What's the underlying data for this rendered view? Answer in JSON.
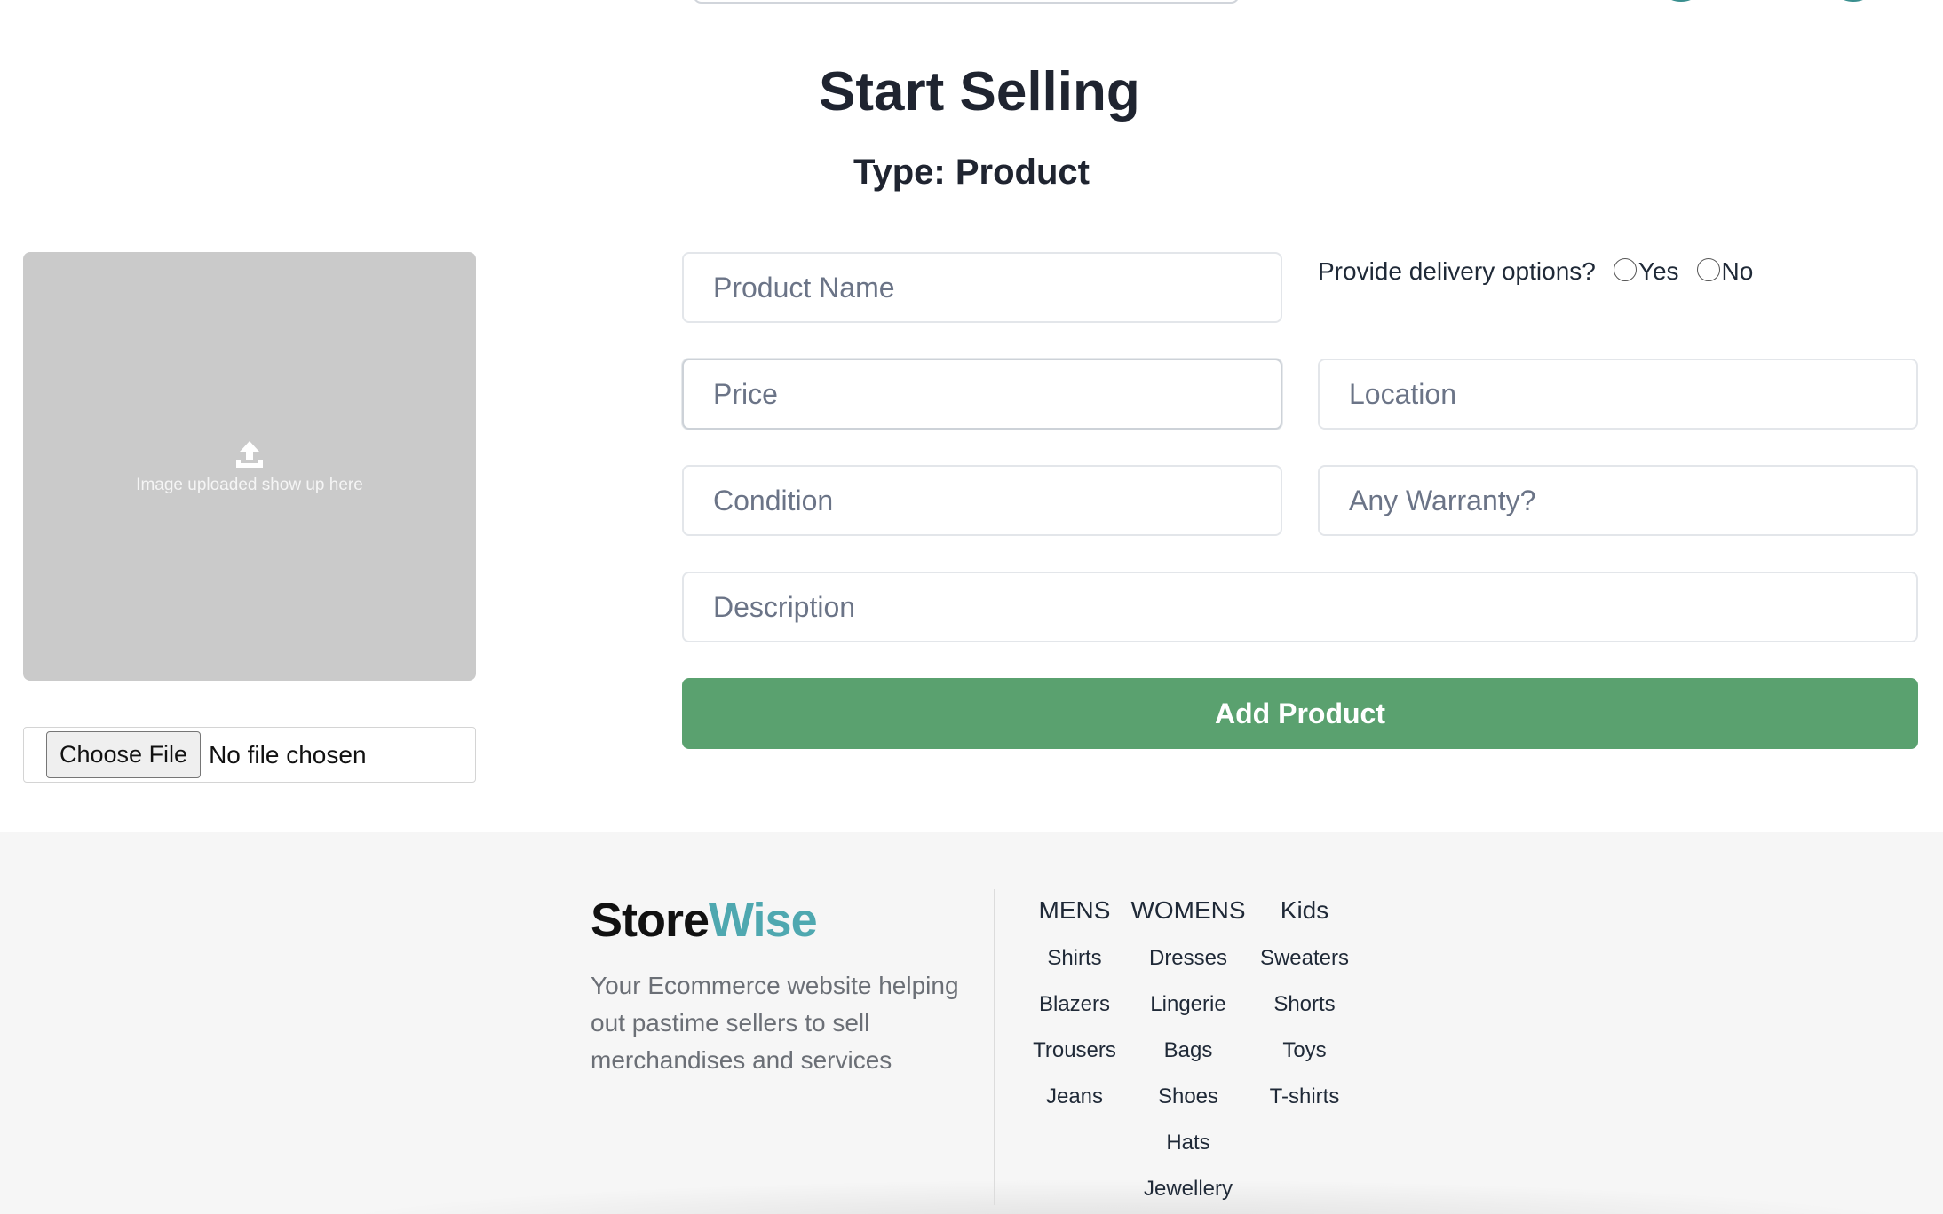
{
  "page": {
    "title": "Start Selling",
    "subtitle": "Type: Product"
  },
  "upload": {
    "preview_text": "Image uploaded show up here",
    "choose_file_label": "Choose File",
    "file_status": "No file chosen"
  },
  "form": {
    "product_name_placeholder": "Product Name",
    "price_placeholder": "Price",
    "location_placeholder": "Location",
    "condition_placeholder": "Condition",
    "warranty_placeholder": "Any Warranty?",
    "description_placeholder": "Description",
    "delivery_question": "Provide delivery options?",
    "delivery_yes": "Yes",
    "delivery_no": "No",
    "submit_label": "Add Product"
  },
  "footer": {
    "brand_part1": "Store",
    "brand_part2": "Wise",
    "description": "Your Ecommerce website helping out pastime sellers to sell merchandises and services",
    "columns": [
      {
        "heading": "MENS",
        "items": [
          "Shirts",
          "Blazers",
          "Trousers",
          "Jeans"
        ]
      },
      {
        "heading": "WOMENS",
        "items": [
          "Dresses",
          "Lingerie",
          "Bags",
          "Shoes",
          "Hats",
          "Jewellery"
        ]
      },
      {
        "heading": "Kids",
        "items": [
          "Sweaters",
          "Shorts",
          "Toys",
          "T-shirts"
        ]
      }
    ]
  },
  "colors": {
    "accent_green": "#5aa16f",
    "brand_teal": "#4fa8b0",
    "preview_gray": "#cacaca"
  },
  "icons": {
    "upload": "upload-icon"
  }
}
